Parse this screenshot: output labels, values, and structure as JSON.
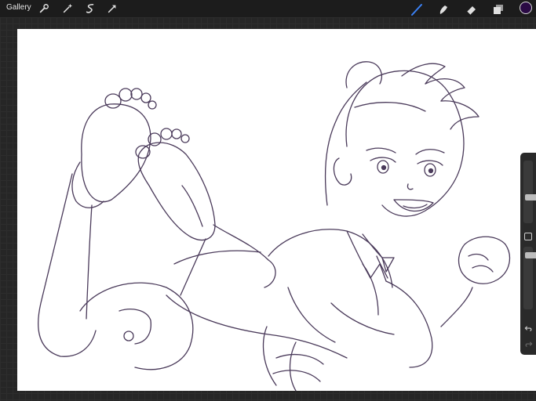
{
  "topbar": {
    "gallery_label": "Gallery",
    "left_tools": [
      {
        "name": "actions-wrench-icon"
      },
      {
        "name": "adjustments-wand-icon"
      },
      {
        "name": "selection-icon"
      },
      {
        "name": "transform-arrow-icon"
      }
    ],
    "right_tools": [
      {
        "name": "brush-icon",
        "active": true
      },
      {
        "name": "smudge-icon",
        "active": false
      },
      {
        "name": "eraser-icon",
        "active": false
      },
      {
        "name": "layers-icon",
        "active": false
      }
    ],
    "current_color": "#2a0a44"
  },
  "colors": {
    "brush_active": "#3b82f6",
    "icon": "#e0e0e0",
    "line_art": "#4a3a5a",
    "canvas": "#ffffff"
  },
  "sidebar": {
    "brush_size": 0.4,
    "opacity": 0.9
  }
}
